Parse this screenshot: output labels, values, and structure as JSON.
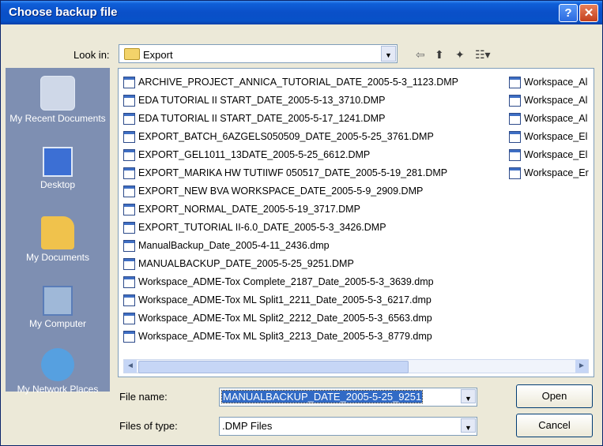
{
  "window": {
    "title": "Choose backup file",
    "help_glyph": "?",
    "close_glyph": "✕"
  },
  "lookin": {
    "label": "Look in:",
    "value": "Export",
    "arrow": "▼"
  },
  "toolbar": {
    "back": "⇦",
    "up": "⬆",
    "new_folder": "✦",
    "views": "☷▾"
  },
  "places": [
    {
      "label": "My Recent Documents"
    },
    {
      "label": "Desktop"
    },
    {
      "label": "My Documents"
    },
    {
      "label": "My Computer"
    },
    {
      "label": "My Network Places"
    }
  ],
  "files_col1": [
    "ARCHIVE_PROJECT_ANNICA_TUTORIAL_DATE_2005-5-3_1123.DMP",
    "EDA TUTORIAL II START_DATE_2005-5-13_3710.DMP",
    "EDA TUTORIAL II START_DATE_2005-5-17_1241.DMP",
    "EXPORT_BATCH_6AZGELS050509_DATE_2005-5-25_3761.DMP",
    "EXPORT_GEL1011_13DATE_2005-5-25_6612.DMP",
    "EXPORT_MARIKA HW TUTIIWF 050517_DATE_2005-5-19_281.DMP",
    "EXPORT_NEW BVA WORKSPACE_DATE_2005-5-9_2909.DMP",
    "EXPORT_NORMAL_DATE_2005-5-19_3717.DMP",
    "EXPORT_TUTORIAL II-6.0_DATE_2005-5-3_3426.DMP",
    "ManualBackup_Date_2005-4-11_2436.dmp",
    "MANUALBACKUP_DATE_2005-5-25_9251.DMP",
    "Workspace_ADME-Tox Complete_2187_Date_2005-5-3_3639.dmp",
    "Workspace_ADME-Tox ML Split1_2211_Date_2005-5-3_6217.dmp",
    "Workspace_ADME-Tox ML Split2_2212_Date_2005-5-3_6563.dmp",
    "Workspace_ADME-Tox ML Split3_2213_Date_2005-5-3_8779.dmp"
  ],
  "files_col2": [
    "Workspace_Al",
    "Workspace_Al",
    "Workspace_Al",
    "Workspace_El",
    "Workspace_El",
    "Workspace_Er"
  ],
  "scroll": {
    "left": "◄",
    "right": "►"
  },
  "filename": {
    "label": "File name:",
    "value": "MANUALBACKUP_DATE_2005-5-25_9251",
    "arrow": "▼"
  },
  "filetype": {
    "label": "Files of type:",
    "value": ".DMP Files",
    "arrow": "▼"
  },
  "buttons": {
    "open": "Open",
    "cancel": "Cancel"
  }
}
